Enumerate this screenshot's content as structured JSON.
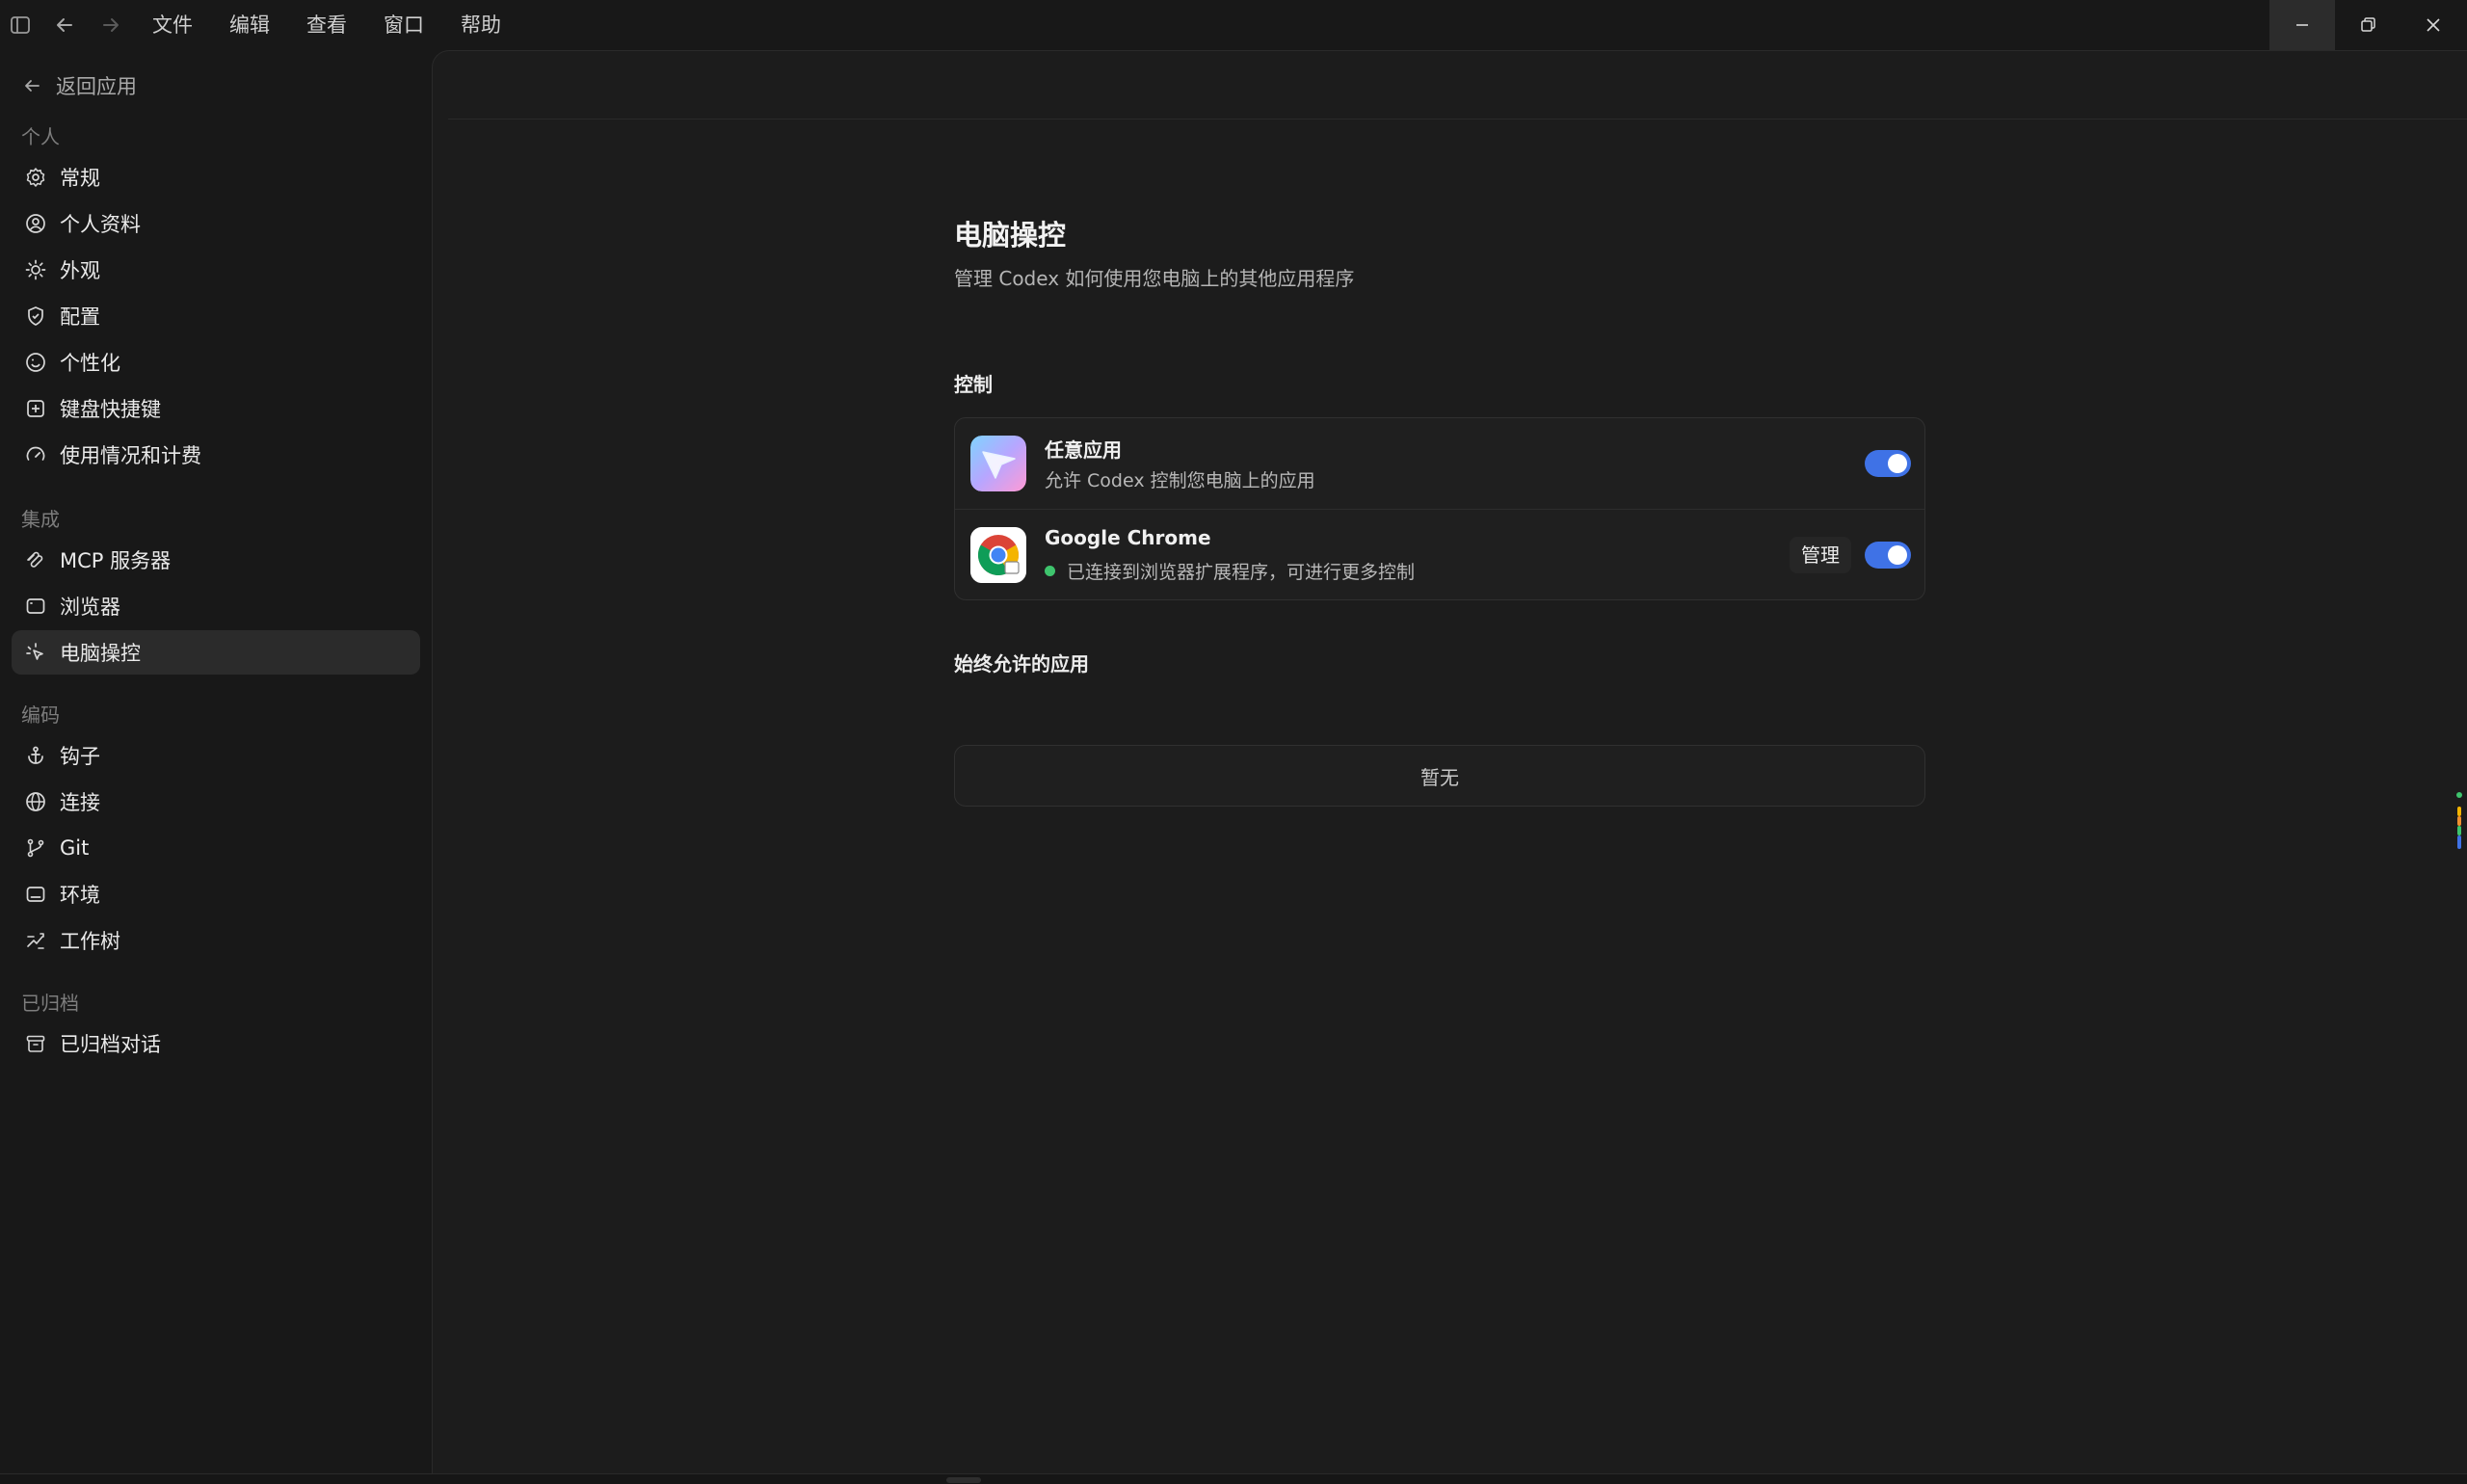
{
  "titlebar": {
    "menu": [
      "文件",
      "编辑",
      "查看",
      "窗口",
      "帮助"
    ],
    "icons": [
      "sidebar-toggle-icon",
      "back-arrow-icon",
      "forward-arrow-icon",
      "minimize-icon",
      "restore-icon",
      "close-icon"
    ]
  },
  "sidebar": {
    "back_label": "返回应用",
    "sections": [
      {
        "title": "个人",
        "items": [
          {
            "label": "常规",
            "icon": "gear-icon"
          },
          {
            "label": "个人资料",
            "icon": "user-circle-icon"
          },
          {
            "label": "外观",
            "icon": "sun-icon"
          },
          {
            "label": "配置",
            "icon": "shield-icon"
          },
          {
            "label": "个性化",
            "icon": "smile-icon"
          },
          {
            "label": "键盘快捷键",
            "icon": "keyboard-icon"
          },
          {
            "label": "使用情况和计费",
            "icon": "gauge-icon"
          }
        ]
      },
      {
        "title": "集成",
        "items": [
          {
            "label": "MCP 服务器",
            "icon": "mcp-icon"
          },
          {
            "label": "浏览器",
            "icon": "browser-icon"
          },
          {
            "label": "电脑操控",
            "icon": "sparkle-cursor-icon",
            "selected": true
          }
        ]
      },
      {
        "title": "编码",
        "items": [
          {
            "label": "钩子",
            "icon": "anchor-icon"
          },
          {
            "label": "连接",
            "icon": "globe-icon"
          },
          {
            "label": "Git",
            "icon": "git-branch-icon"
          },
          {
            "label": "环境",
            "icon": "monitor-icon"
          },
          {
            "label": "工作树",
            "icon": "worktree-icon"
          }
        ]
      },
      {
        "title": "已归档",
        "items": [
          {
            "label": "已归档对话",
            "icon": "archive-icon"
          }
        ]
      }
    ]
  },
  "main": {
    "title": "电脑操控",
    "subtitle": "管理 Codex 如何使用您电脑上的其他应用程序",
    "control_section": {
      "title": "控制",
      "rows": [
        {
          "name": "任意应用",
          "description": "允许 Codex 控制您电脑上的应用",
          "enabled": true,
          "icon": "any-app-icon"
        },
        {
          "name": "Google Chrome",
          "description": "已连接到浏览器扩展程序，可进行更多控制",
          "enabled": true,
          "icon": "chrome-icon",
          "status_color": "#3ec46d",
          "manage_label": "管理"
        }
      ]
    },
    "always_allowed_section": {
      "title": "始终允许的应用",
      "empty_text": "暂无"
    }
  },
  "colors": {
    "accent": "#3f72e6",
    "status_ok": "#3ec46d",
    "background": "#181818"
  }
}
